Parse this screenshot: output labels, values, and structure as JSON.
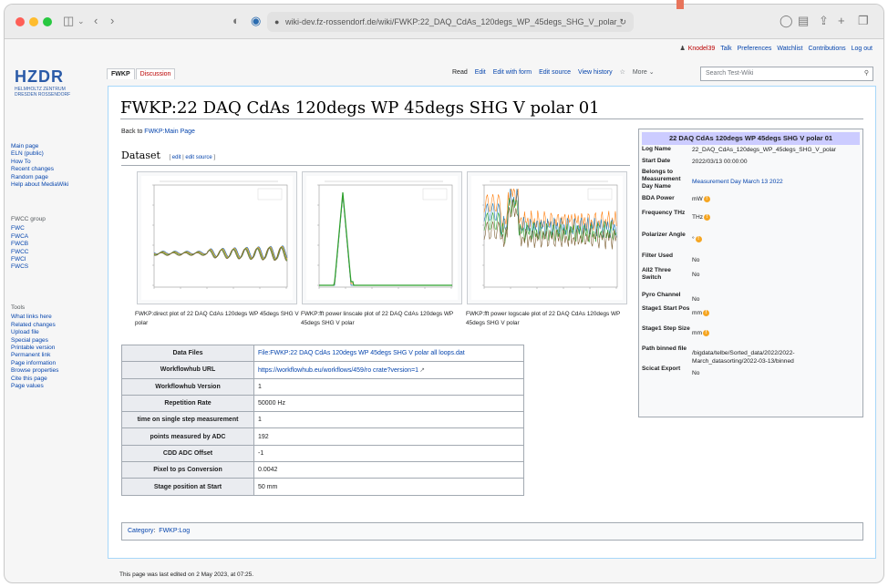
{
  "browser": {
    "url": "wiki-dev.fz-rossendorf.de/wiki/FWKP:22_DAQ_CdAs_120degs_WP_45degs_SHG_V_polar_"
  },
  "personal": [
    "Knodel39",
    "Talk",
    "Preferences",
    "Watchlist",
    "Contributions",
    "Log out"
  ],
  "logo": {
    "name": "HZDR",
    "line1": "HELMHOLTZ ZENTRUM",
    "line2": "DRESDEN ROSSENDORF"
  },
  "nav": {
    "main": [
      "Main page",
      "ELN (public)",
      "How To",
      "Recent changes",
      "Random page",
      "Help about MediaWiki"
    ],
    "fwcc_heading": "FWCC group",
    "fwcc": [
      "FWC",
      "FWCA",
      "FWCB",
      "FWCC",
      "FWCI",
      "FWCS"
    ],
    "tools_heading": "Tools",
    "tools": [
      "What links here",
      "Related changes",
      "Upload file",
      "Special pages",
      "Printable version",
      "Permanent link",
      "Page information",
      "Browse properties",
      "Cite this page",
      "Page values"
    ]
  },
  "tabs": {
    "left": [
      "FWKP",
      "Discussion"
    ],
    "right": [
      "Read",
      "Edit",
      "Edit with form",
      "Edit source",
      "View history"
    ],
    "more": "More",
    "search_placeholder": "Search Test-Wiki"
  },
  "page": {
    "title": "FWKP:22 DAQ CdAs 120degs WP 45degs SHG V polar 01",
    "back_text": "Back to ",
    "back_link": "FWKP:Main Page",
    "section": "Dataset",
    "edit_links": [
      "edit",
      "edit source"
    ]
  },
  "thumbs": [
    {
      "caption": "FWKP:direct plot of 22 DAQ CdAs 120degs WP 45degs SHG V polar"
    },
    {
      "caption": "FWKP:fft power linscale plot of 22 DAQ CdAs 120degs WP 45degs SHG V polar"
    },
    {
      "caption": "FWKP:fft power logscale plot of 22 DAQ CdAs 120degs WP 45degs SHG V polar"
    }
  ],
  "data_table": [
    {
      "key": "Data Files",
      "value": "File:FWKP:22 DAQ CdAs 120degs WP 45degs SHG V polar all loops.dat",
      "link": true
    },
    {
      "key": "Workflowhub URL",
      "value": "https://workflowhub.eu/workflows/459/ro crate?version=1",
      "link": true
    },
    {
      "key": "Workflowhub Version",
      "value": "1",
      "link": false
    },
    {
      "key": "Repetition Rate",
      "value": "50000 Hz",
      "link": false
    },
    {
      "key": "time on single step measurement",
      "value": "1",
      "link": false
    },
    {
      "key": "points measured by ADC",
      "value": "192",
      "link": false
    },
    {
      "key": "CDD ADC Offset",
      "value": "-1",
      "link": false
    },
    {
      "key": "Pixel to ps Conversion",
      "value": "0.0042",
      "link": false
    },
    {
      "key": "Stage position at Start",
      "value": "50 mm",
      "link": false
    }
  ],
  "infobox": {
    "title": "22 DAQ CdAs 120degs WP 45degs SHG V polar 01",
    "rows": [
      {
        "key": "Log Name",
        "value": "22_DAQ_CdAs_120degs_WP_45degs_SHG_V_polar"
      },
      {
        "key": "Start Date",
        "value": "2022/03/13 00:00:00"
      },
      {
        "key": "Belongs to Measurement Day Name",
        "value": "Measurement Day March 13 2022",
        "link": true
      },
      {
        "key": "BDA Power",
        "value": "mW",
        "warn": true
      },
      {
        "key": "Frequency THz",
        "value": "THz",
        "warn": true
      },
      {
        "key": "Polarizer Angle",
        "value": "°",
        "warn": true
      },
      {
        "key": "Filter Used",
        "value": "No"
      },
      {
        "key": "All2 Three Switch",
        "value": "No"
      },
      {
        "key": "Pyro Channel",
        "value": "No"
      },
      {
        "key": "Stage1 Start Pos",
        "value": "mm",
        "warn": true
      },
      {
        "key": "Stage1 Step Size",
        "value": "mm",
        "warn": true
      },
      {
        "key": "Path binned file",
        "value": "/bigdata/telbe/Sorted_data/2022/2022-March_datasorting/2022-03-13/binned"
      },
      {
        "key": "Scicat Export",
        "value": "No"
      }
    ]
  },
  "category": {
    "label": "Category",
    "value": "FWKP:Log"
  },
  "footer": "This page was last edited on 2 May 2023, at 07:25."
}
